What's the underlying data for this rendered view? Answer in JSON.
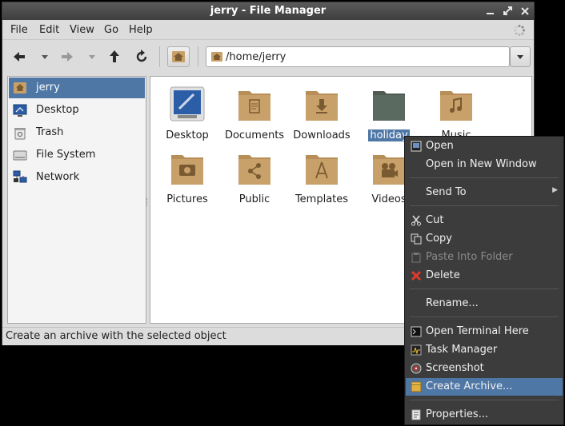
{
  "window": {
    "title": "jerry - File Manager",
    "controls": [
      "minimize-icon",
      "maximize-icon",
      "close-icon"
    ]
  },
  "menubar": {
    "items": [
      "File",
      "Edit",
      "View",
      "Go",
      "Help"
    ]
  },
  "toolbar": {
    "buttons": [
      "back-icon",
      "back-history-icon",
      "forward-icon",
      "forward-history-icon",
      "up-icon",
      "reload-icon",
      "home-icon"
    ],
    "location": "/home/jerry"
  },
  "sidebar": {
    "items": [
      {
        "label": "jerry",
        "icon": "home-folder-icon",
        "selected": true
      },
      {
        "label": "Desktop",
        "icon": "desktop-icon"
      },
      {
        "label": "Trash",
        "icon": "trash-icon"
      },
      {
        "label": "File System",
        "icon": "drive-icon"
      },
      {
        "label": "Network",
        "icon": "network-icon"
      }
    ]
  },
  "files": [
    {
      "label": "Desktop",
      "icon": "desktop-folder-icon"
    },
    {
      "label": "Documents",
      "icon": "documents-folder-icon"
    },
    {
      "label": "Downloads",
      "icon": "downloads-folder-icon"
    },
    {
      "label": "holiday",
      "icon": "folder-icon",
      "selected": true
    },
    {
      "label": "Music",
      "icon": "music-folder-icon"
    },
    {
      "label": "Pictures",
      "icon": "pictures-folder-icon"
    },
    {
      "label": "Public",
      "icon": "public-folder-icon"
    },
    {
      "label": "Templates",
      "icon": "templates-folder-icon"
    },
    {
      "label": "Videos",
      "icon": "videos-folder-icon"
    }
  ],
  "status": "Create an archive with the selected object",
  "context_menu": {
    "items": [
      {
        "label": "Open",
        "icon": "open-icon"
      },
      {
        "label": "Open in New Window"
      },
      {
        "label": "Send To",
        "submenu": true
      },
      {
        "label": "Cut",
        "icon": "cut-icon"
      },
      {
        "label": "Copy",
        "icon": "copy-icon"
      },
      {
        "label": "Paste Into Folder",
        "icon": "paste-icon",
        "disabled": true
      },
      {
        "label": "Delete",
        "icon": "delete-icon"
      },
      {
        "label": "Rename..."
      },
      {
        "label": "Open Terminal Here",
        "icon": "terminal-icon"
      },
      {
        "label": "Task Manager",
        "icon": "task-manager-icon"
      },
      {
        "label": "Screenshot",
        "icon": "screenshot-icon"
      },
      {
        "label": "Create Archive...",
        "icon": "archive-icon",
        "highlighted": true
      },
      {
        "label": "Properties...",
        "icon": "properties-icon"
      }
    ]
  },
  "colors": {
    "selection": "#4f77a6",
    "folder": "#c8a06a",
    "menu_bg": "#3c3c3c"
  }
}
